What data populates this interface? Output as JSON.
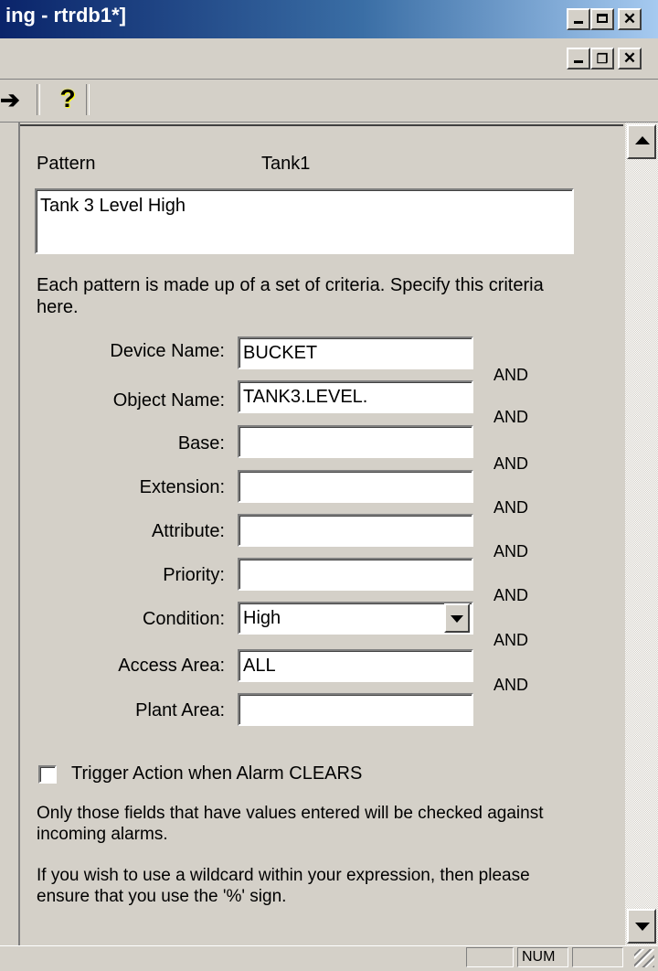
{
  "window": {
    "title": "ing - rtrdb1*]"
  },
  "pattern": {
    "label": "Pattern",
    "name": "Tank1",
    "description": "Tank 3 Level High"
  },
  "intro": "Each pattern is made up of a set of criteria. Specify this criteria here.",
  "criteria": [
    {
      "label": "Device Name:",
      "value": "BUCKET"
    },
    {
      "label": "Object Name:",
      "value": "TANK3.LEVEL."
    },
    {
      "label": "Base:",
      "value": ""
    },
    {
      "label": "Extension:",
      "value": ""
    },
    {
      "label": "Attribute:",
      "value": ""
    },
    {
      "label": "Priority:",
      "value": ""
    },
    {
      "label": "Condition:",
      "value": "High"
    },
    {
      "label": "Access Area:",
      "value": "ALL"
    },
    {
      "label": "Plant Area:",
      "value": ""
    }
  ],
  "and_label": "AND",
  "trigger": {
    "label": "Trigger Action when Alarm CLEARS",
    "checked": false
  },
  "notes": [
    "Only those fields that have values entered will be checked against incoming alarms.",
    "If you wish to use a wildcard within your expression, then please ensure that you use the '%' sign."
  ],
  "statusbar": {
    "num": "NUM"
  }
}
